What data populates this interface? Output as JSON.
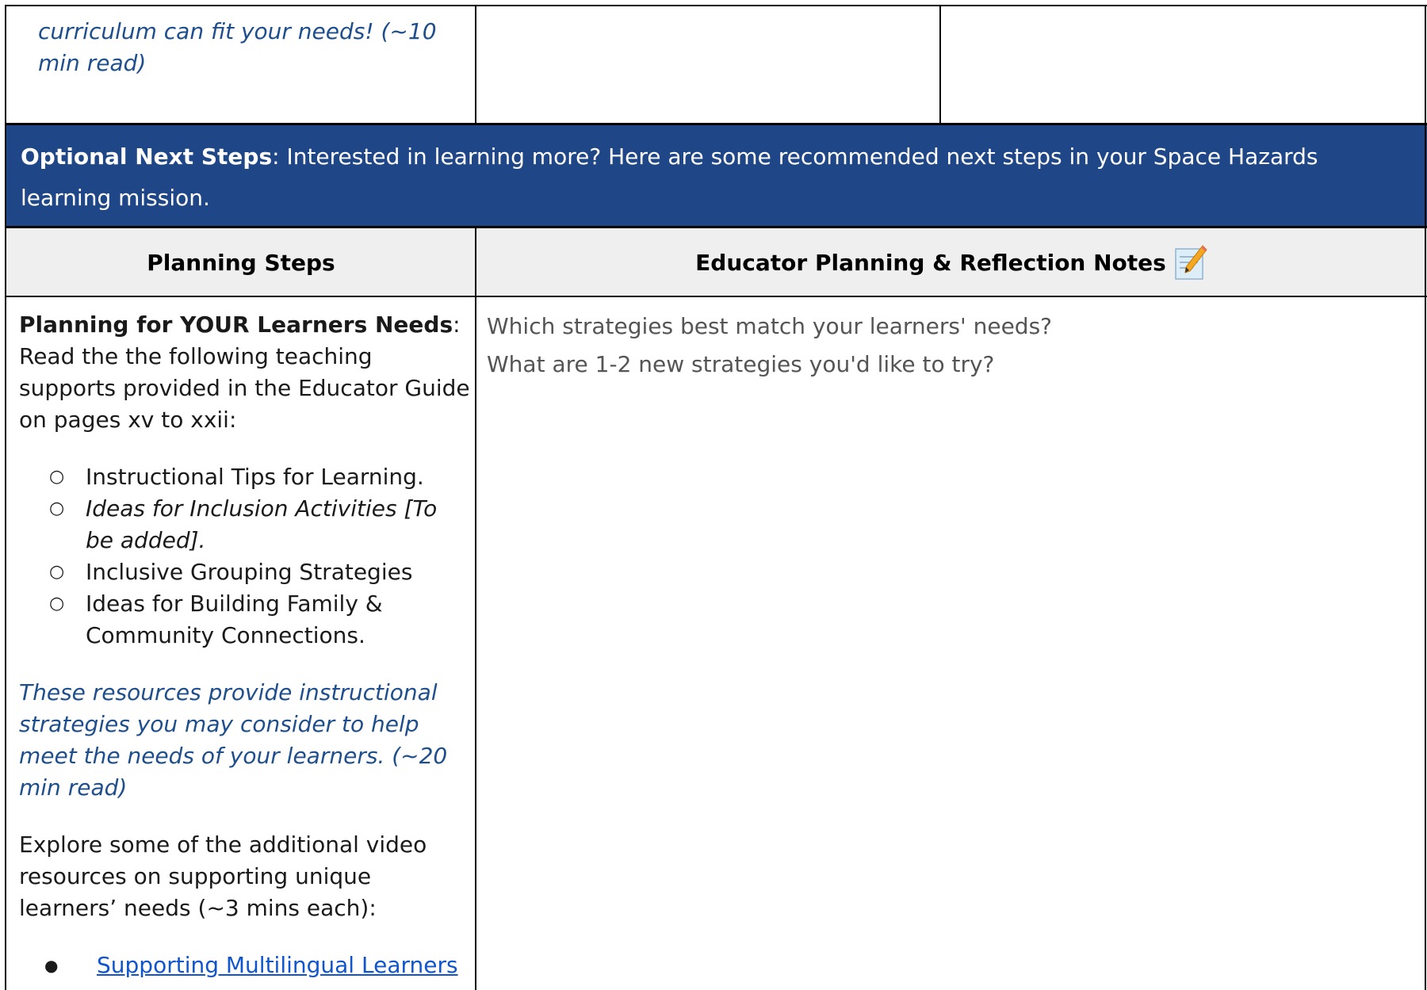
{
  "top_row": {
    "col1_italic": "curriculum can fit your needs! (~10 min read)"
  },
  "banner": {
    "label_bold": "Optional Next Steps",
    "text": ":  Interested in learning more?  Here are some recommended next steps in your Space Hazards learning mission."
  },
  "table_header": {
    "col1": "Planning Steps",
    "col2": "Educator Planning & Reflection Notes"
  },
  "planning": {
    "heading_bold": "Planning for YOUR Learners Needs",
    "intro": "Read the the following teaching supports provided in the Educator Guide on pages xv to xxii:",
    "supports": [
      {
        "text": "Instructional Tips for Learning.",
        "italic": false
      },
      {
        "text": "Ideas for Inclusion Activities [To be added].",
        "italic": true
      },
      {
        "text": "Inclusive Grouping Strategies",
        "italic": false
      },
      {
        "text": "Ideas for Building Family & Community Connections.",
        "italic": false
      }
    ],
    "resources_note": "These resources provide instructional strategies you may consider to help meet the needs of your learners.  (~20 min read)",
    "video_intro": "Explore some of the additional video resources on supporting unique learners’ needs (~3 mins each):",
    "video_links": [
      "Supporting Multilingual Learners"
    ]
  },
  "notes": {
    "prompts": [
      "Which strategies best match your learners' needs?",
      "What are 1-2 new strategies you'd like to try?"
    ]
  },
  "icons": {
    "pencil": "memo-pencil-icon"
  }
}
